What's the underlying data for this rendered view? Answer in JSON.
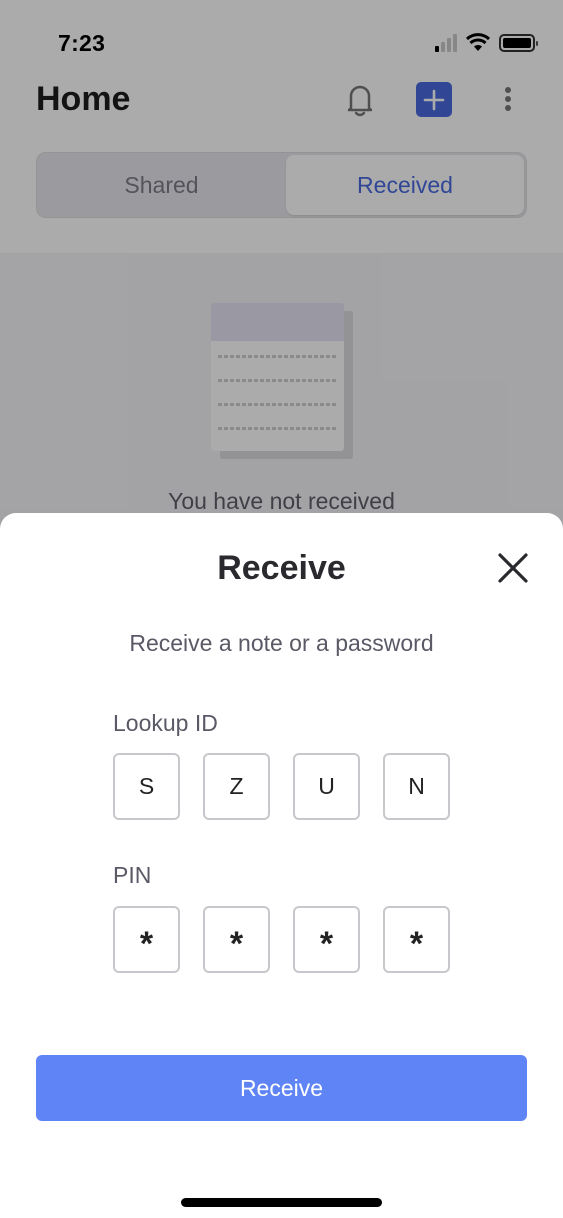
{
  "status_bar": {
    "time": "7:23"
  },
  "header": {
    "title": "Home"
  },
  "icons": {
    "bell": "bell-icon",
    "add": "plus-icon",
    "more": "more-vertical-icon",
    "close": "close-icon"
  },
  "tabs": [
    {
      "label": "Shared",
      "active": false
    },
    {
      "label": "Received",
      "active": true
    }
  ],
  "empty_state": {
    "text": "You have not received"
  },
  "sheet": {
    "title": "Receive",
    "subtitle": "Receive a note or a password",
    "lookup_label": "Lookup ID",
    "lookup_values": [
      "S",
      "Z",
      "U",
      "N"
    ],
    "pin_label": "PIN",
    "pin_values": [
      "*",
      "*",
      "*",
      "*"
    ],
    "submit_label": "Receive"
  },
  "colors": {
    "accent": "#4a6ae0",
    "button": "#5f84f5"
  }
}
